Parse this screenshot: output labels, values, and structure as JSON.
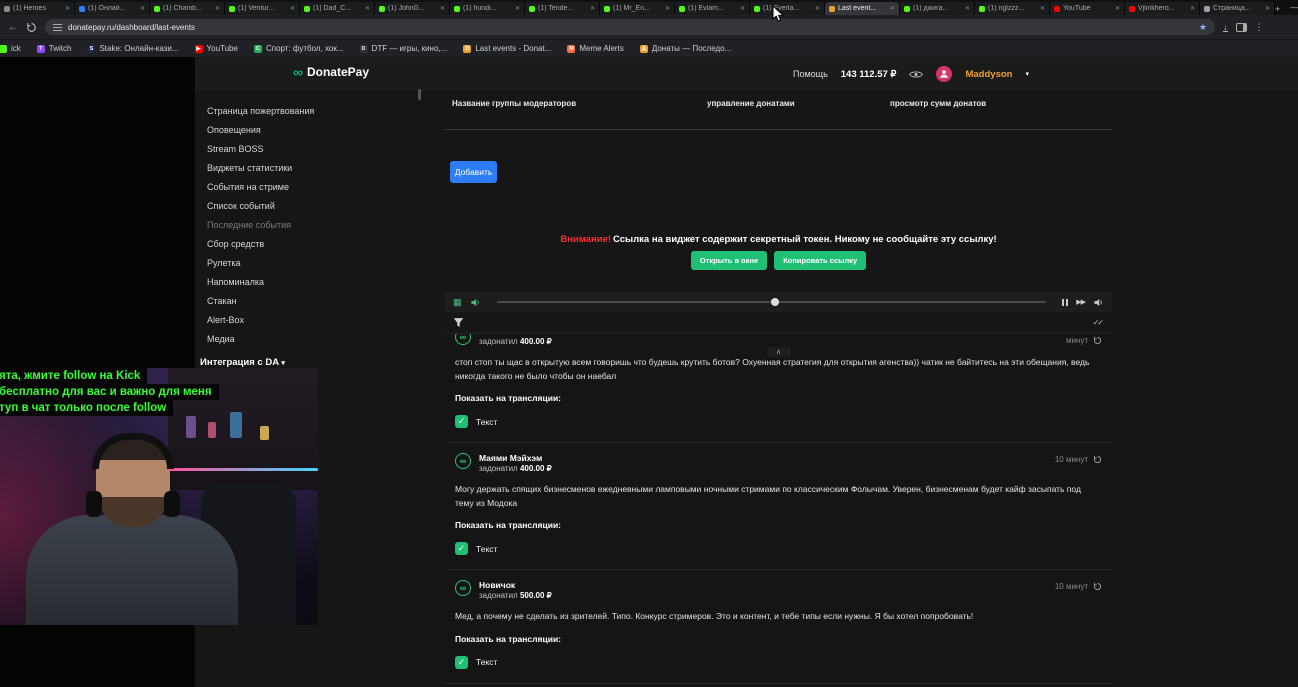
{
  "colors": {
    "accent_green": "#1fbf75",
    "accent_blue": "#2e7cf6",
    "warning_red": "#ff2a2a",
    "username_orange": "#f0a12c",
    "logo_green": "#00b37e",
    "cam_text_green": "#32ff32"
  },
  "icons": {
    "close": "✕",
    "plus": "+",
    "minimize": "—",
    "back": "←",
    "star": "★",
    "menu": "⋮",
    "infinity": "∞",
    "check": "✓",
    "double_check": "✓✓",
    "chevron_up": "∧",
    "caret_down": "▾",
    "grid": "▦",
    "fast_forward": "▶▶"
  },
  "browser": {
    "address": "donatepay.ru/dashboard/last-events",
    "tabs": [
      {
        "label": "(1) Heroes",
        "color": "#8a8a8a"
      },
      {
        "label": "(1) Онлай...",
        "color": "#2d7ff9"
      },
      {
        "label": "(1) Chamb...",
        "color": "#53fc18"
      },
      {
        "label": "(1) Ventur...",
        "color": "#53fc18"
      },
      {
        "label": "(1) Dad_C...",
        "color": "#53fc18"
      },
      {
        "label": "(1) JohnG...",
        "color": "#53fc18"
      },
      {
        "label": "(1) hundi...",
        "color": "#53fc18"
      },
      {
        "label": "(1) Tende...",
        "color": "#53fc18"
      },
      {
        "label": "(1) Mr_En...",
        "color": "#53fc18"
      },
      {
        "label": "(1) Evlam...",
        "color": "#53fc18"
      },
      {
        "label": "(1) Everla...",
        "color": "#53fc18"
      },
      {
        "label": "Last event...",
        "color": "#f0a12c"
      },
      {
        "label": "(1) джига...",
        "color": "#53fc18"
      },
      {
        "label": "(1) nglzzz...",
        "color": "#53fc18"
      },
      {
        "label": "YouTube",
        "color": "#ff0000"
      },
      {
        "label": "Vjlinkhero...",
        "color": "#ff0000"
      },
      {
        "label": "Страница...",
        "color": "#9aa0a6"
      }
    ],
    "bookmarks": [
      {
        "label": "ick",
        "color": "#53fc18",
        "letter": ""
      },
      {
        "label": "Twitch",
        "color": "#9146ff",
        "letter": "T"
      },
      {
        "label": "Stake: Онлайн-кази...",
        "color": "#1b2a4a",
        "letter": "S"
      },
      {
        "label": "YouTube",
        "color": "#ff0000",
        "letter": "▶"
      },
      {
        "label": "Спорт: футбол, хок...",
        "color": "#2bab5c",
        "letter": "С"
      },
      {
        "label": "DTF — игры, кино,...",
        "color": "#2f2f2f",
        "letter": "D"
      },
      {
        "label": "Last events - Donat...",
        "color": "#f0a12c",
        "letter": "D"
      },
      {
        "label": "Meme Alerts",
        "color": "#ff6b35",
        "letter": "M"
      },
      {
        "label": "Донаты — Последо...",
        "color": "#f0a12c",
        "letter": "Д"
      }
    ]
  },
  "header": {
    "logo_text": "DonatePay",
    "help": "Помощь",
    "balance": "143 112.57 ₽",
    "username": "Maddyson"
  },
  "sidebar": {
    "items": [
      "Страница пожертвования",
      "Оповещения",
      "Stream BOSS",
      "Виджеты статистики",
      "События на стриме",
      "Список событий",
      "Последние события",
      "Сбор средств",
      "Рулетка",
      "Напоминалка",
      "Стакан",
      "Alert-Box",
      "Медиа"
    ],
    "integration_label": "Интеграция с DA"
  },
  "content": {
    "table_headers": [
      "Название группы модераторов",
      "управление донатами",
      "просмотр сумм донатов"
    ],
    "add_button": "Добавить",
    "warning_prefix": "Внимание!",
    "warning_text": "Ссылка на виджет содержит секретный токен. Никому не сообщайте эту ссылку!",
    "open_window_button": "Открыть в окне",
    "copy_link_button": "Копировать ссылку"
  },
  "donations": [
    {
      "name": "",
      "verb": "задонатил",
      "amount": "400.00 ₽",
      "time": "минут",
      "message": "стоп стоп ты щас в открытую всем говоришь что будешь крутить ботов? Охуенная стратегия для открытия агенства)) чатик не байтитесь на эти обещания, ведь никогда такого не было чтобы он наебал",
      "show_label": "Показать на трансляции:",
      "checkbox_label": "Текст"
    },
    {
      "name": "Маями Мэйхэм",
      "verb": "задонатил",
      "amount": "400.00 ₽",
      "time": "10 минут",
      "message": "Могу держать спящих бизнесменов ежедневными ламповыми ночными стримами по классическим Фолычам. Уверен, бизнесменам будет кайф засыпать под тему из Модока",
      "show_label": "Показать на трансляции:",
      "checkbox_label": "Текст"
    },
    {
      "name": "Новичок",
      "verb": "задонатил",
      "amount": "500.00 ₽",
      "time": "10 минут",
      "message": "Мед, а почему не сделать из зрителей. Типо. Конкурс стримеров. Это и контент, и тебе типы если нужны. Я бы хотел попробовать!",
      "show_label": "Показать на трансляции:",
      "checkbox_label": "Текст"
    }
  ],
  "webcam": {
    "lines": [
      "ята, жмите follow на Kick",
      "бесплатно для вас и важно для меня",
      "туп в чат только после follow"
    ]
  }
}
